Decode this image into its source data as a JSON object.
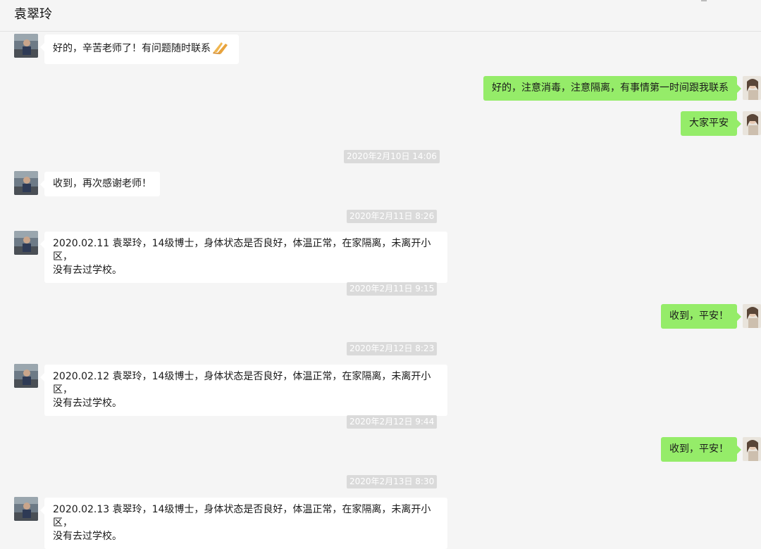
{
  "header": {
    "title": "袁翠玲"
  },
  "messages": [
    {
      "text": "好的，辛苦老师了！有问题随时联系",
      "emoji": "folded-hands"
    },
    {
      "text": "好的，注意消毒，注意隔离，有事情第一时间跟我联系"
    },
    {
      "text": "大家平安"
    },
    {
      "time": "2020年2月10日 14:06"
    },
    {
      "text": "收到，再次感谢老师！"
    },
    {
      "time": "2020年2月11日 8:26"
    },
    {
      "text": "2020.02.11 袁翠玲，14级博士，身体状态是否良好，体温正常，在家隔离，未离开小区，\n没有去过学校。"
    },
    {
      "time": "2020年2月11日 9:15"
    },
    {
      "text": "收到，平安！"
    },
    {
      "time": "2020年2月12日 8:23"
    },
    {
      "text": "2020.02.12 袁翠玲，14级博士，身体状态是否良好，体温正常，在家隔离，未离开小区，\n没有去过学校。"
    },
    {
      "time": "2020年2月12日 9:44"
    },
    {
      "text": "收到，平安！"
    },
    {
      "time": "2020年2月13日 8:30"
    },
    {
      "text": "2020.02.13 袁翠玲，14级博士，身体状态是否良好，体温正常，在家隔离，未离开小区，\n没有去过学校。"
    }
  ],
  "colors": {
    "background": "#f5f5f5",
    "incoming_bubble": "#ffffff",
    "outgoing_bubble": "#95ec69",
    "timestamp_bg": "#dadada"
  },
  "icons": {
    "header_left": "pin-icon",
    "header_right": "more-icon",
    "emoji": "folded-hands-emoji-icon"
  }
}
